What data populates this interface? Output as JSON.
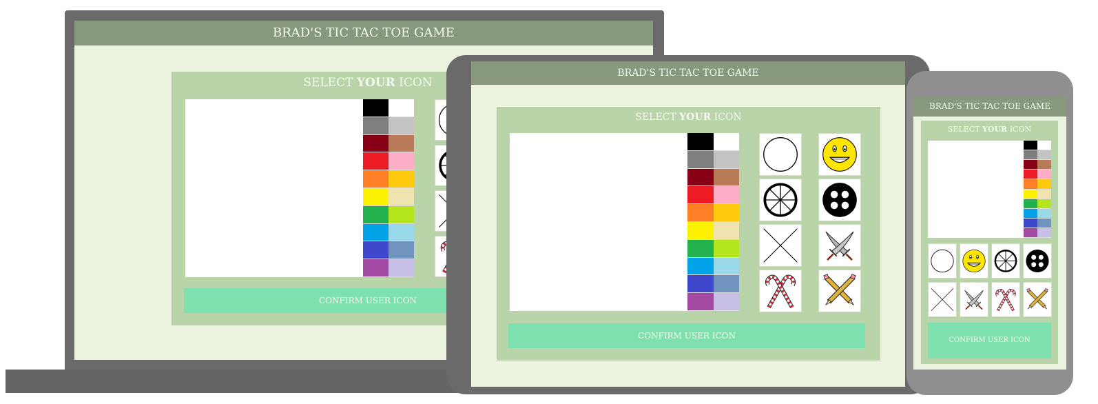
{
  "app": {
    "title": "BRAD'S TIC TAC TOE GAME",
    "select_prefix": "SELECT ",
    "select_emphasis": "YOUR",
    "select_suffix": " ICON",
    "confirm_label": "CONFIRM USER ICON"
  },
  "palette": [
    "#000000",
    "#ffffff",
    "#7f7f7f",
    "#c3c3c3",
    "#880015",
    "#b97a57",
    "#ed1c24",
    "#ffaec9",
    "#ff7f27",
    "#ffc90e",
    "#fff200",
    "#efe4b0",
    "#22b14c",
    "#b5e61d",
    "#00a2e8",
    "#99d9ea",
    "#3f48cc",
    "#7092be",
    "#a349a4",
    "#c8bfe7"
  ],
  "icons": [
    "circle-icon",
    "smiley-icon",
    "wheel-icon",
    "button-icon",
    "x-icon",
    "swords-icon",
    "candy-canes-icon",
    "pencils-icon"
  ],
  "colors": {
    "device": "#6a6a6a",
    "header": "#87987c",
    "screen": "#ebf3df",
    "panel": "#b9d4a8",
    "button": "#7ee0ae",
    "text_light": "#f4f9ee"
  }
}
